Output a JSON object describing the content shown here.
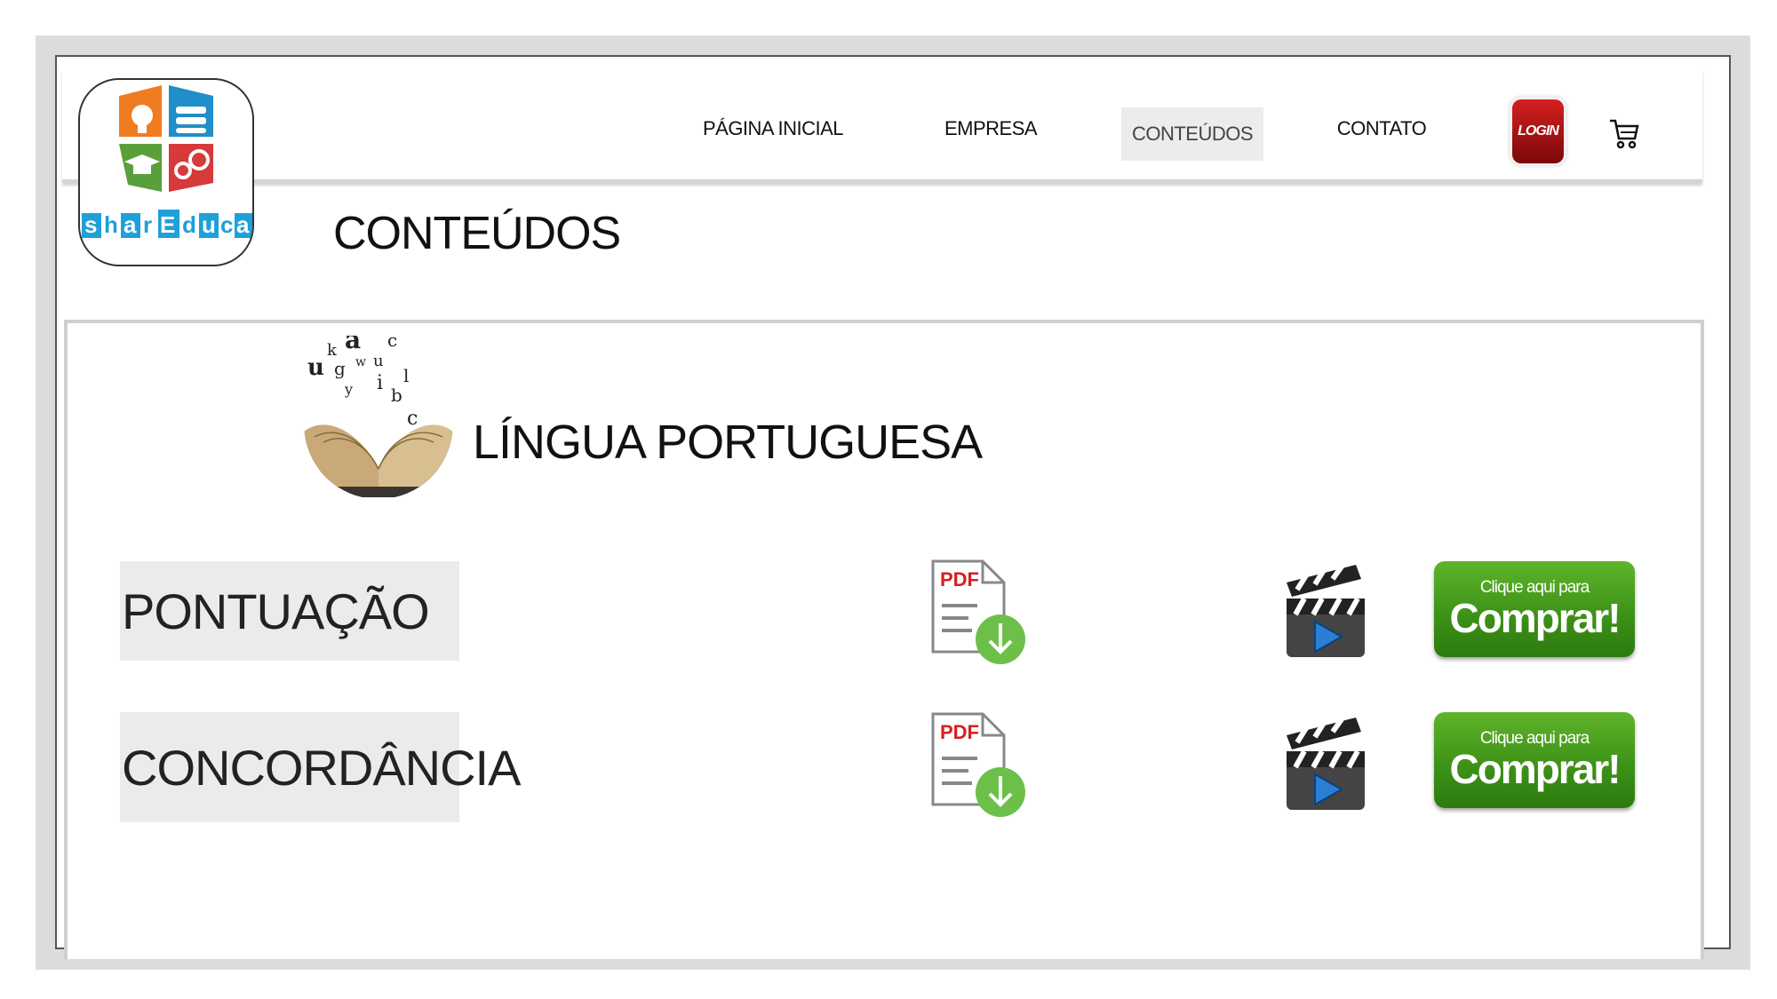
{
  "brand": {
    "logo_text": "shareduca"
  },
  "nav": {
    "items": [
      {
        "label": "PÁGINA INICIAL"
      },
      {
        "label": "EMPRESA"
      },
      {
        "label": "CONTEÚDOS",
        "active": true
      },
      {
        "label": "CONTATO"
      }
    ],
    "login_label": "LOGIN"
  },
  "page": {
    "title": "CONTEÚDOS"
  },
  "subject": {
    "title": "LÍNGUA PORTUGUESA",
    "topics": [
      {
        "label": "PONTUAÇÃO",
        "pdf_label": "PDF",
        "buy_small": "Clique aqui para",
        "buy_big": "Comprar!"
      },
      {
        "label": "CONCORDÂNCIA",
        "pdf_label": "PDF",
        "buy_small": "Clique aqui para",
        "buy_big": "Comprar!"
      }
    ]
  },
  "colors": {
    "login": "#b01010",
    "buy": "#3e9218",
    "pdf_red": "#d42020",
    "download_green": "#6cc04a",
    "play_blue": "#2a7fd4"
  },
  "icons": [
    "shareduca-logo-icon",
    "cart-icon",
    "book-letters-icon",
    "pdf-download-icon",
    "video-clapper-icon"
  ]
}
